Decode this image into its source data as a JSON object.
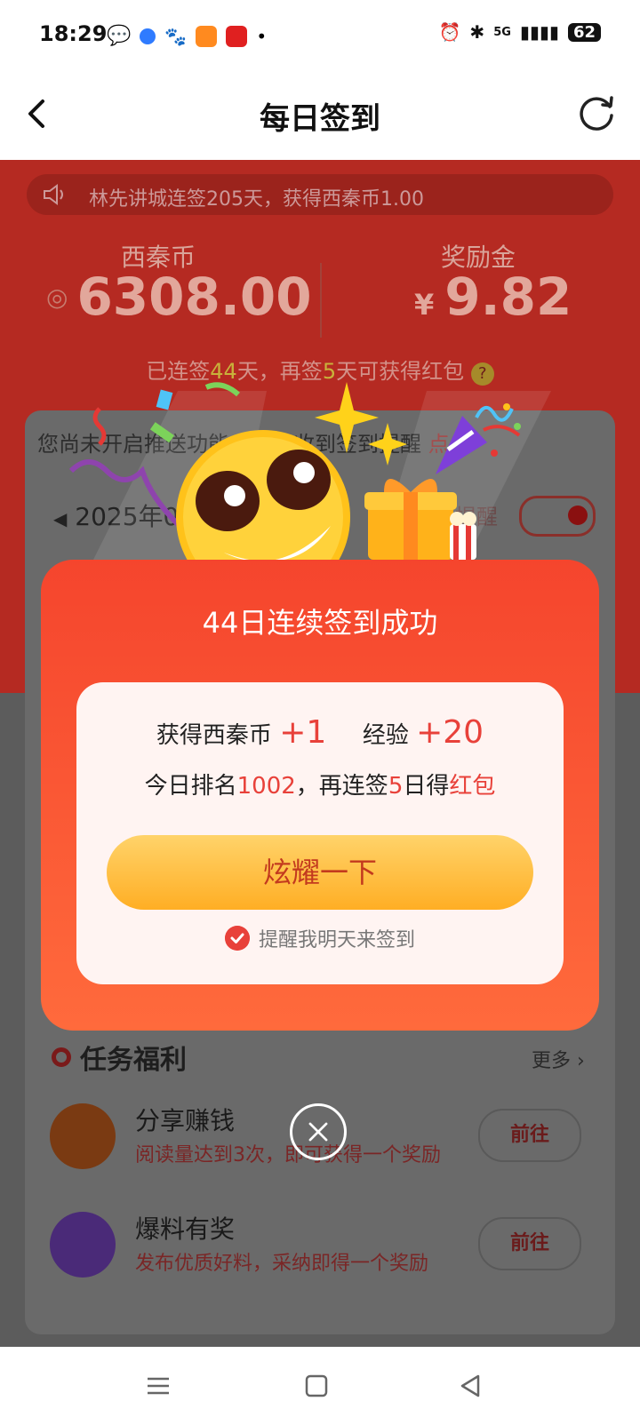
{
  "status_bar": {
    "time": "18:29",
    "network": "5G",
    "battery": "62"
  },
  "header": {
    "title": "每日签到"
  },
  "background": {
    "ticker": "林先讲城连签205天，获得西秦币1.00",
    "coin_label": "西秦币",
    "coin_value": "6308.00",
    "bonus_label": "奖励金",
    "bonus_currency": "¥",
    "bonus_value": "9.82",
    "streak_prefix": "已连签",
    "streak_days": "44",
    "streak_mid": "天，再签",
    "streak_more": "5",
    "streak_suffix": "天可获得红包",
    "notice_text": "您尚未开启推送功能，无法收到签到提醒",
    "notice_action": "点击",
    "date_text": "2025年0",
    "remind_label": "提醒",
    "tasks_title": "任务福利",
    "more_label": "更多",
    "tasks": [
      {
        "name": "分享赚钱",
        "desc": "阅读量达到3次，即可获得一个奖励",
        "button": "前往"
      },
      {
        "name": "爆料有奖",
        "desc": "发布优质好料，采纳即得一个奖励",
        "button": "前往"
      }
    ]
  },
  "popup": {
    "title": "44日连续签到成功",
    "coin_label": "获得西秦币",
    "coin_gain": "+1",
    "exp_label": "经验",
    "exp_gain": "+20",
    "rank_prefix": "今日排名",
    "rank_value": "1002",
    "rank_mid": "，再连签",
    "rank_days": "5",
    "rank_suffix": "日得",
    "rank_reward": "红包",
    "cta_label": "炫耀一下",
    "remind_label": "提醒我明天来签到"
  },
  "colors": {
    "accent": "#e8413a",
    "popup_top": "#f5452d",
    "popup_bottom": "#ff6a3c",
    "cta": "#ffae24"
  }
}
